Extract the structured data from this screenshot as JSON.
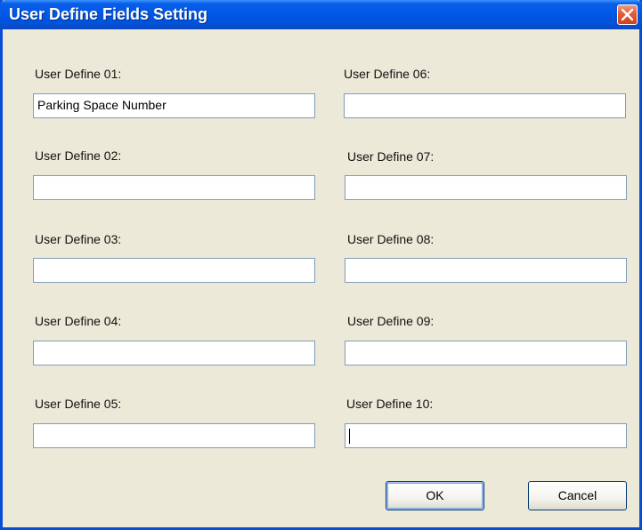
{
  "window": {
    "title": "User Define Fields Setting"
  },
  "fields": [
    {
      "label": "User Define 01:",
      "value": "Parking Space Number"
    },
    {
      "label": "User Define 02:",
      "value": ""
    },
    {
      "label": "User Define 03:",
      "value": ""
    },
    {
      "label": "User Define 04:",
      "value": ""
    },
    {
      "label": "User Define 05:",
      "value": ""
    },
    {
      "label": "User Define 06:",
      "value": ""
    },
    {
      "label": "User Define 07:",
      "value": ""
    },
    {
      "label": "User Define 08:",
      "value": ""
    },
    {
      "label": "User Define 09:",
      "value": ""
    },
    {
      "label": "User Define 10:",
      "value": ""
    }
  ],
  "buttons": {
    "ok": "OK",
    "cancel": "Cancel"
  },
  "colors": {
    "titlebar": "#0058E6",
    "dialog_bg": "#ECE9D8",
    "input_border": "#7F9DB9",
    "close_button": "#D2401C"
  }
}
